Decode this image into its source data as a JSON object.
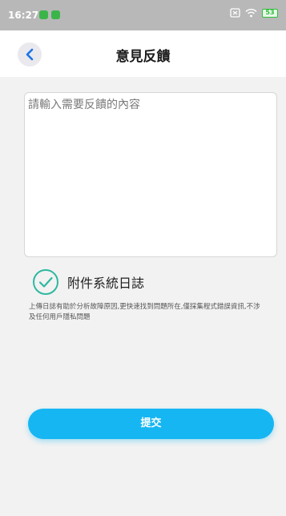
{
  "status_bar": {
    "time": "16:27",
    "battery": "53"
  },
  "nav": {
    "title": "意見反饋",
    "back_icon": "chevron-left-icon"
  },
  "feedback": {
    "placeholder": "請輸入需要反饋的內容"
  },
  "attach_log": {
    "label": "附件系統日誌",
    "checked": true,
    "icon": "check-circle-icon"
  },
  "note": "上傳日誌有助於分析故障原因,更快速找到問題所在,僅採集程式錯誤資訊,不涉及任何用戶隱私問題",
  "submit": {
    "label": "提交"
  },
  "colors": {
    "accent": "#16b6f3",
    "check_green": "#2fb8a0",
    "back_chevron": "#1a73e8"
  }
}
